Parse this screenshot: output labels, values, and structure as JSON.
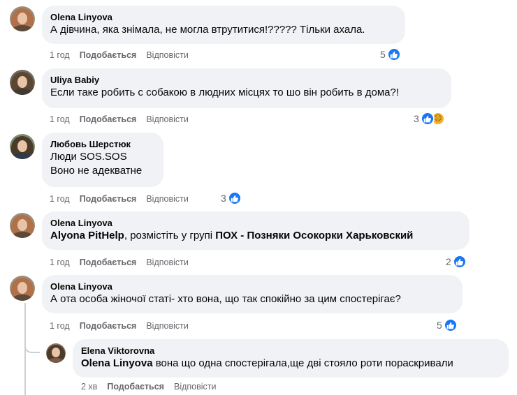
{
  "comments": [
    {
      "author": "Olena Linyova",
      "line1": "А дівчина, яка знімала, не могла втрутитися!????? Тільки ахала.",
      "time": "1 год",
      "like_label": "Подобається",
      "reply_label": "Відповісти",
      "reaction_count": "5",
      "reactions": [
        "like-icon"
      ]
    },
    {
      "author": "Uliya Babiy",
      "line1": "Если таке робить с собакою в людних місцях то шо він робить в дома?!",
      "time": "1 год",
      "like_label": "Подобається",
      "reply_label": "Відповісти",
      "reaction_count": "3",
      "reactions": [
        "like-icon",
        "sad-icon"
      ]
    },
    {
      "author": "Любовь Шерстюк",
      "line1": "Люди SOS.SOS",
      "line2": "Воно не адекватне",
      "time": "1 год",
      "like_label": "Подобається",
      "reply_label": "Відповісти",
      "reaction_count": "3",
      "reactions": [
        "like-icon"
      ]
    },
    {
      "author": "Olena Linyova",
      "mention1": "Alyona PitHelp",
      "text_mid": ", розмістіть у групі",
      "mention2": "ПОХ - Позняки Осокорки Харьковский",
      "time": "1 год",
      "like_label": "Подобається",
      "reply_label": "Відповісти",
      "reaction_count": "2",
      "reactions": [
        "like-icon"
      ]
    },
    {
      "author": "Olena Linyova",
      "line1": "А ота особа жіночої статі- хто вона, що так спокійно за цим спостерігає?",
      "time": "1 год",
      "like_label": "Подобається",
      "reply_label": "Відповісти",
      "reaction_count": "5",
      "reactions": [
        "like-icon"
      ]
    },
    {
      "author": "Elena Viktorovna",
      "mention": "Olena Linyova",
      "text": "вона що одна спостерігала,ще дві стояло роти пораскривали",
      "time": "2 хв",
      "like_label": "Подобається",
      "reply_label": "Відповісти"
    }
  ],
  "colors": {
    "bubble": "#f0f2f5",
    "meta_text": "#65676b",
    "like_blue": "#1877f2",
    "sad_yellow": "#f7b125"
  }
}
